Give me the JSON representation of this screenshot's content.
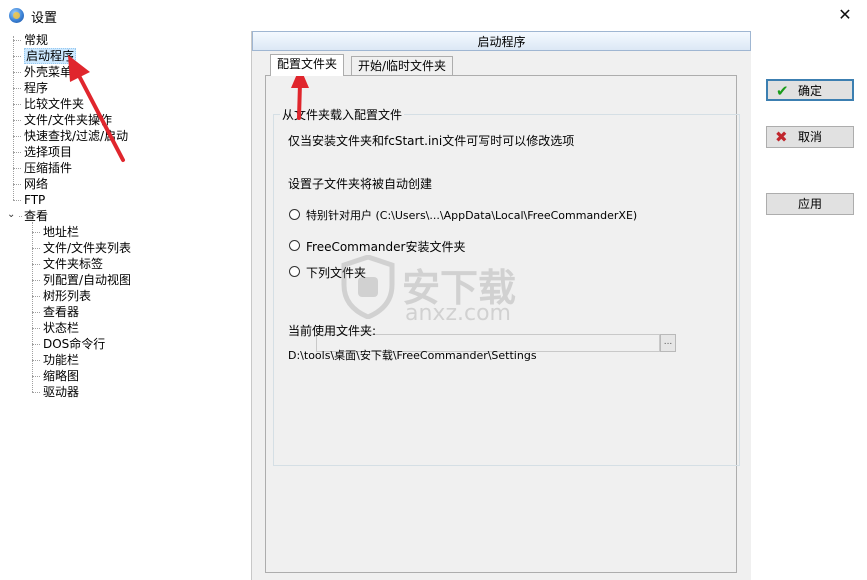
{
  "window": {
    "title": "设置",
    "close_glyph": "✕"
  },
  "tree": {
    "items": [
      {
        "label": "常规",
        "level": 0
      },
      {
        "label": "启动程序",
        "level": 0,
        "selected": true
      },
      {
        "label": "外壳菜单",
        "level": 0
      },
      {
        "label": "程序",
        "level": 0
      },
      {
        "label": "比较文件夹",
        "level": 0
      },
      {
        "label": "文件/文件夹操作",
        "level": 0
      },
      {
        "label": "快速查找/过滤/启动",
        "level": 0
      },
      {
        "label": "选择项目",
        "level": 0
      },
      {
        "label": "压缩插件",
        "level": 0
      },
      {
        "label": "网络",
        "level": 0
      },
      {
        "label": "FTP",
        "level": 0
      },
      {
        "label": "查看",
        "level": 0,
        "expanded": true
      },
      {
        "label": "地址栏",
        "level": 1
      },
      {
        "label": "文件/文件夹列表",
        "level": 1
      },
      {
        "label": "文件夹标签",
        "level": 1
      },
      {
        "label": "列配置/自动视图",
        "level": 1
      },
      {
        "label": "树形列表",
        "level": 1
      },
      {
        "label": "查看器",
        "level": 1
      },
      {
        "label": "状态栏",
        "level": 1
      },
      {
        "label": "DOS命令行",
        "level": 1
      },
      {
        "label": "功能栏",
        "level": 1
      },
      {
        "label": "缩略图",
        "level": 1
      },
      {
        "label": "驱动器",
        "level": 1
      }
    ],
    "expander_glyph": "⌄"
  },
  "panel": {
    "header": "启动程序",
    "tabs": [
      {
        "label": "配置文件夹",
        "active": true
      },
      {
        "label": "开始/临时文件夹",
        "active": false
      }
    ],
    "group_title": "从文件夹载入配置文件",
    "note": "仅当安装文件夹和fcStart.ini文件可写时可以修改选项",
    "subfolder_note": "设置子文件夹将被自动创建",
    "options": [
      {
        "label": "特别针对用户 (C:\\Users\\...\\AppData\\Local\\FreeCommanderXE)",
        "checked": false
      },
      {
        "label": "FreeCommander安装文件夹",
        "checked": false
      },
      {
        "label": "下列文件夹",
        "checked": false
      }
    ],
    "path_value": "",
    "browse_label": "...",
    "current_label": "当前使用文件夹:",
    "current_path": "D:\\tools\\桌面\\安下载\\FreeCommander\\Settings"
  },
  "buttons": {
    "ok": {
      "label": "确定",
      "icon": "check-icon",
      "glyph": "✔",
      "color": "#1a9c1a"
    },
    "cancel": {
      "label": "取消",
      "icon": "x-icon",
      "glyph": "✖",
      "color": "#c0262d"
    },
    "apply": {
      "label": "应用"
    }
  },
  "watermark": {
    "text": "安下载",
    "sub": "anxz.com"
  },
  "colors": {
    "annotation_arrow": "#e0262d",
    "selection": "#cce8ff"
  }
}
